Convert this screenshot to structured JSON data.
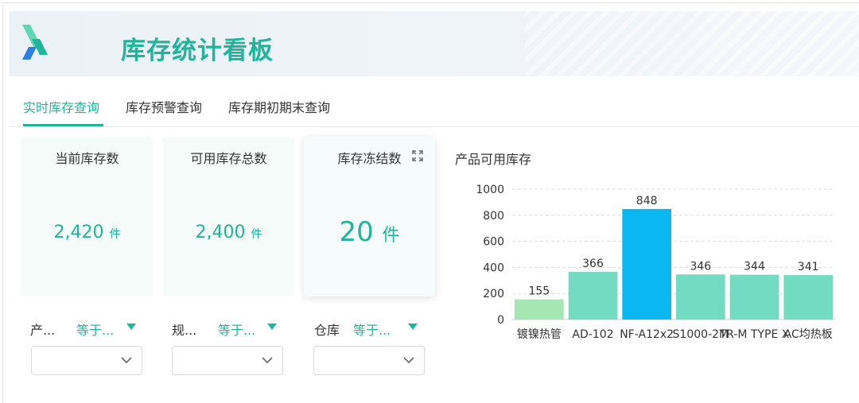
{
  "header": {
    "title": "库存统计看板",
    "logo_icon": "logo-icon"
  },
  "tabs": [
    {
      "label": "实时库存查询",
      "active": true
    },
    {
      "label": "库存预警查询",
      "active": false
    },
    {
      "label": "库存期初期末查询",
      "active": false
    }
  ],
  "cards": [
    {
      "label": "当前库存数",
      "value": "2,420",
      "unit": "件"
    },
    {
      "label": "可用库存总数",
      "value": "2,400",
      "unit": "件"
    },
    {
      "label": "库存冻结数",
      "value": "20",
      "unit": "件",
      "icon": "expand-icon"
    }
  ],
  "filters": [
    {
      "label": "产...",
      "operator": "等于...",
      "value": ""
    },
    {
      "label": "规...",
      "operator": "等于...",
      "value": ""
    },
    {
      "label": "仓库",
      "operator": "等于...",
      "value": ""
    }
  ],
  "colors": {
    "accent": "#1fb59a",
    "bar_default": "#74dbc3",
    "bar_highlight": "#0bb7f0",
    "bar_first": "#a6e6b3"
  },
  "chart_data": {
    "type": "bar",
    "title": "产品可用库存",
    "categories": [
      "镀镍热管",
      "AD-102",
      "NF-A12x25",
      "S1000-2M",
      "TR-M TYPE X",
      "AC均热板"
    ],
    "tick_labels_shown": [
      "镀镍热管",
      "AD-102",
      "NF-A12x2",
      "S1000-2M",
      "TR-M TYPE X",
      "AC均热板"
    ],
    "values": [
      155,
      366,
      848,
      346,
      344,
      341
    ],
    "xlabel": "",
    "ylabel": "",
    "ylim": [
      0,
      1000
    ],
    "yticks": [
      0,
      200,
      400,
      600,
      800,
      1000
    ],
    "grid": true,
    "legend": "none"
  }
}
